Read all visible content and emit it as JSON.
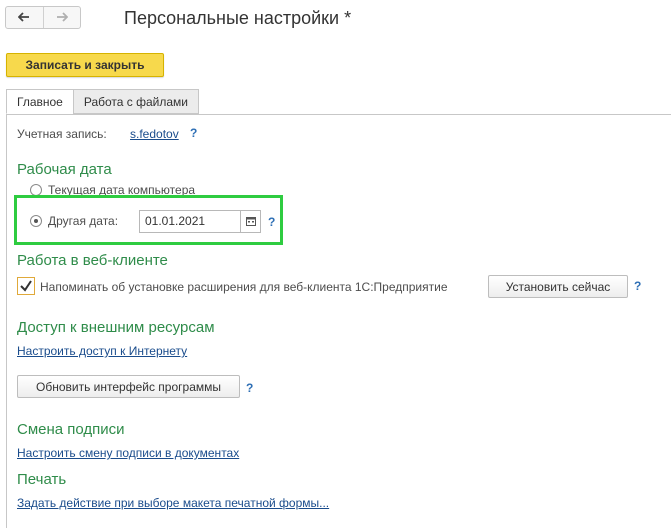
{
  "header": {
    "back_icon": "arrow-left-icon",
    "forward_icon": "arrow-right-icon",
    "title": "Персональные настройки *"
  },
  "toolbar": {
    "save_close_label": "Записать и закрыть"
  },
  "tabs": [
    {
      "label": "Главное",
      "active": true
    },
    {
      "label": "Работа с файлами",
      "active": false
    }
  ],
  "account": {
    "label": "Учетная запись:",
    "value": "s.fedotov",
    "help": "?"
  },
  "work_date": {
    "heading": "Рабочая дата",
    "option_computer": "Текущая дата компьютера",
    "option_other": "Другая дата:",
    "selected": "other",
    "date_value": "01.01.2021",
    "help": "?"
  },
  "web_client": {
    "heading": "Работа в веб-клиенте",
    "remind_label": "Напоминать об установке расширения для веб-клиента 1С:Предприятие",
    "remind_checked": true,
    "install_button": "Установить сейчас",
    "help": "?"
  },
  "external": {
    "heading": "Доступ к внешним ресурсам",
    "internet_link": "Настроить доступ к Интернету",
    "refresh_button": "Обновить интерфейс программы",
    "help": "?"
  },
  "signature": {
    "heading": "Смена подписи",
    "link": "Настроить смену подписи в документах"
  },
  "print": {
    "heading": "Печать",
    "link": "Задать действие при выборе макета печатной формы..."
  },
  "colors": {
    "accent_green": "#2f8c4a",
    "highlight": "#2ecc40",
    "primary_button": "#f7d94c",
    "link": "#1a4c8c"
  }
}
